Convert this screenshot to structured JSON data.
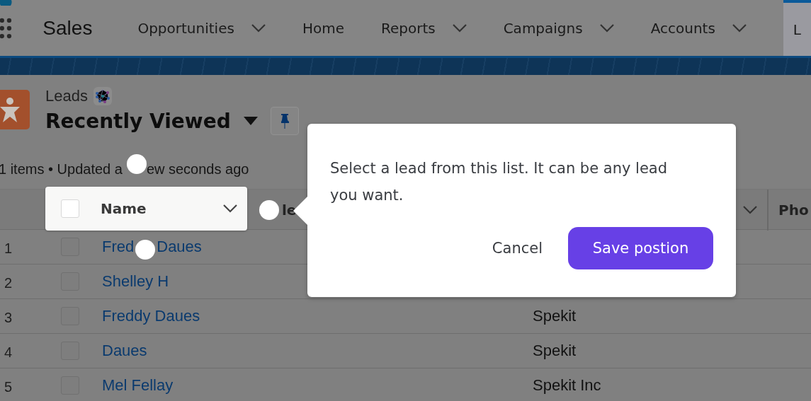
{
  "nav": {
    "app_name": "Sales",
    "items": [
      {
        "label": "Opportunities",
        "dropdown": true,
        "selected": false
      },
      {
        "label": "Home",
        "dropdown": false,
        "selected": false
      },
      {
        "label": "Reports",
        "dropdown": true,
        "selected": false
      },
      {
        "label": "Campaigns",
        "dropdown": true,
        "selected": false
      },
      {
        "label": "Accounts",
        "dropdown": true,
        "selected": false
      },
      {
        "label": "L",
        "dropdown": false,
        "selected": true
      }
    ]
  },
  "header": {
    "object": "Leads",
    "list_view": "Recently Viewed",
    "meta": [
      "1 items • Updated a",
      "ew seconds ago"
    ]
  },
  "table": {
    "select_all_checked": false,
    "columns": [
      {
        "label": "Name",
        "highlighted": true,
        "dropdown": true
      },
      {
        "label": "le",
        "highlighted": false,
        "dropdown": false
      },
      {
        "highlighted": false,
        "dropdown": true
      },
      {
        "label": "Pho",
        "highlighted": false,
        "dropdown": false
      }
    ],
    "rows": [
      {
        "number": "1",
        "name": [
          "Fred",
          "Daues"
        ],
        "checked": false
      },
      {
        "number": "2",
        "name": "Shelley H",
        "checked": false
      },
      {
        "number": "3",
        "name": "Freddy Daues",
        "company": "Spekit",
        "checked": false
      },
      {
        "number": "4",
        "name": "Daues",
        "company": "Spekit",
        "checked": false
      },
      {
        "number": "5",
        "name": "Mel Fellay",
        "company": "Spekit Inc",
        "checked": false
      }
    ]
  },
  "popover": {
    "message": "Select a lead from this list. It can be any lead you want.",
    "buttons": [
      {
        "label": "Cancel",
        "kind": "secondary"
      },
      {
        "label": "Save postion",
        "kind": "primary"
      }
    ]
  }
}
